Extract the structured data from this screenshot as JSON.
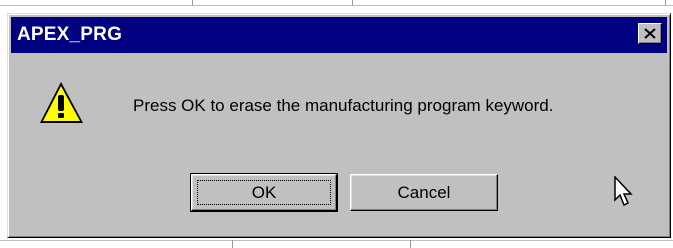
{
  "dialog": {
    "title": "APEX_PRG",
    "message": "Press OK to erase the manufacturing program keyword.",
    "icon": "warning-icon",
    "close_icon": "close-icon",
    "buttons": {
      "ok": "OK",
      "cancel": "Cancel"
    }
  },
  "colors": {
    "titlebar": "#000080",
    "dialog_face": "#c0c0c0",
    "warning_fill": "#ffff00"
  }
}
